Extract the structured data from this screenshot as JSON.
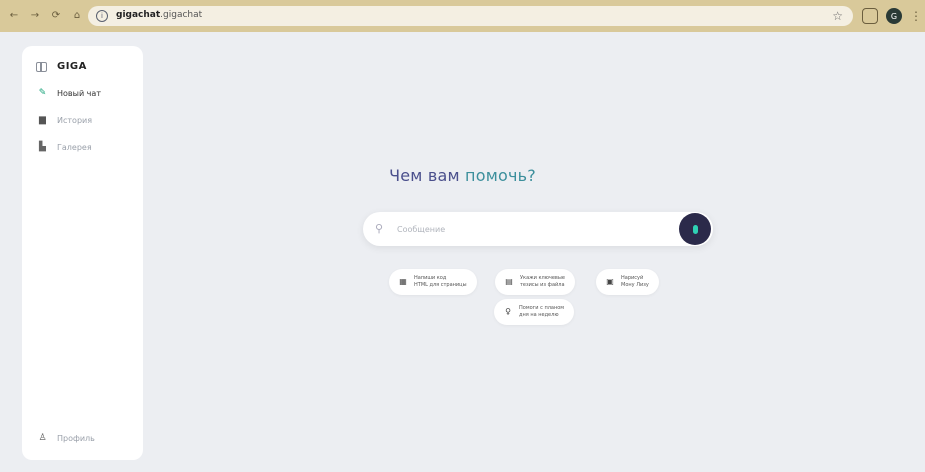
{
  "browser": {
    "nav_icons": [
      "←",
      "→",
      "⟳",
      "⌂"
    ],
    "url_domain": "gigachat",
    "url_path": ".gigachat",
    "profile_initial": "G"
  },
  "sidebar": {
    "logo": "GIGA",
    "items": [
      {
        "label": "Новый чат",
        "icon": "pencil-icon"
      },
      {
        "label": "История",
        "icon": "chat-icon"
      },
      {
        "label": "Галерея",
        "icon": "gallery-icon"
      }
    ],
    "profile_label": "Профиль"
  },
  "main": {
    "headline_part1": "Чем вам",
    "headline_part2": "помочь?",
    "input_placeholder": "Сообщение",
    "chips": [
      {
        "line1": "Напиши код",
        "line2": "HTML для страницы",
        "icon": "code-icon"
      },
      {
        "line1": "Укажи ключевые",
        "line2": "тезисы из файла",
        "icon": "file-icon"
      },
      {
        "line1": "Нарисуй",
        "line2": "Мону Лизу",
        "icon": "image-icon"
      },
      {
        "line1": "Помоги с планом",
        "line2": "дня на неделю",
        "icon": "bulb-icon"
      }
    ]
  },
  "colors": {
    "background": "#eceef2",
    "headline": "#4a4f8c",
    "accent_teal": "#3c8f9c",
    "mic_button": "#2b2a4a",
    "mic_glyph": "#2fd1b4"
  }
}
